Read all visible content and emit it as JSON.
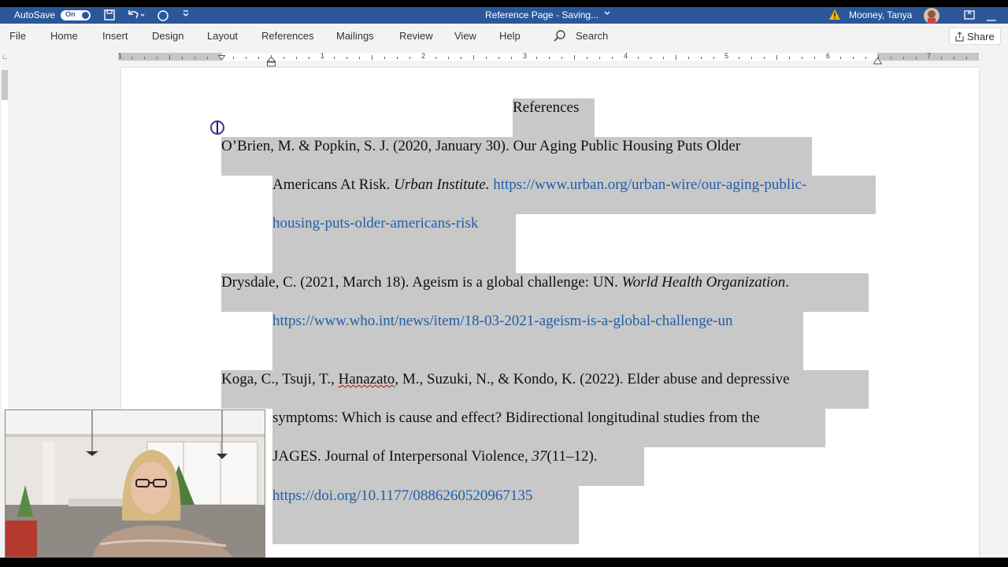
{
  "titlebar": {
    "autosave_label": "AutoSave",
    "autosave_state": "On",
    "doc_title": "Reference Page  -  Saving...",
    "user_name": "Mooney,  Tanya"
  },
  "menu": {
    "tabs": [
      "File",
      "Home",
      "Insert",
      "Design",
      "Layout",
      "References",
      "Mailings",
      "Review",
      "View",
      "Help"
    ],
    "search_label": "Search",
    "share_label": "Share"
  },
  "ruler": {
    "numbers": [
      "1",
      "1",
      "2",
      "3",
      "4",
      "5",
      "6",
      "7"
    ]
  },
  "document": {
    "heading": "References",
    "ref1": {
      "l1": "O’Brien, M. & Popkin, S. J. (2020, January 30). Our Aging Public Housing Puts Older",
      "l2_text": "Americans At Risk. ",
      "l2_italic": "Urban Institute.",
      "l2_link": "https://www.urban.org/urban-wire/our-aging-public-",
      "l3_link": "housing-puts-older-americans-risk"
    },
    "ref2": {
      "l1_text": "Drysdale, C. (2021, March 18). Ageism is a global challenge: UN. ",
      "l1_italic": "World Health Organization",
      "l1_end": ".",
      "l2_link": "https://www.who.int/news/item/18-03-2021-ageism-is-a-global-challenge-un"
    },
    "ref3": {
      "l1_a": "Koga, C., Tsuji, T., ",
      "l1_squiggle": "Hanazato",
      "l1_b": ", M., Suzuki, N., & Kondo, K. (2022). Elder abuse and depressive",
      "l2": "symptoms: Which is cause and effect? Bidirectional longitudinal studies from the",
      "l3_text": "JAGES. Journal of Interpersonal Violence",
      "l3_italic": ", 37",
      "l3_end": "(11–12).",
      "l4_link": "https://doi.org/10.1177/0886260520967135"
    }
  },
  "colors": {
    "title_bar": "#2b579a",
    "selection": "#c8c8c8",
    "hyperlink": "#1f5fa8"
  }
}
